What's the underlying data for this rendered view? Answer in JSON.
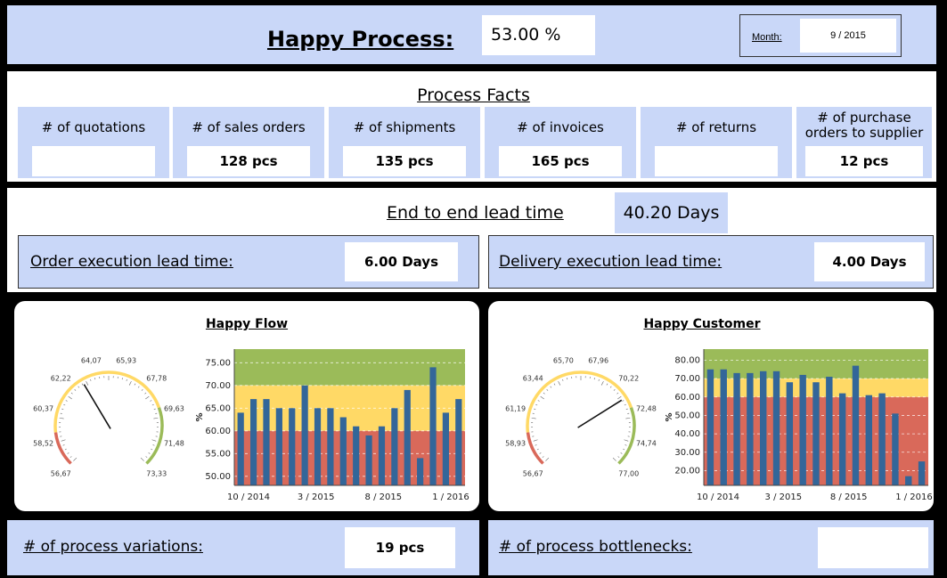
{
  "header": {
    "title": "Happy Process:",
    "happy_process_value": "53.00 %",
    "month_label": "Month:",
    "month_value": "9 / 2015"
  },
  "process_facts": {
    "title": "Process Facts",
    "items": [
      {
        "label": "# of quotations",
        "value": ""
      },
      {
        "label": "# of sales orders",
        "value": "128 pcs"
      },
      {
        "label": "# of shipments",
        "value": "135 pcs"
      },
      {
        "label": "# of invoices",
        "value": "165 pcs"
      },
      {
        "label": "# of returns",
        "value": ""
      },
      {
        "label": "# of purchase orders to supplier",
        "value": "12 pcs"
      }
    ]
  },
  "lead_time": {
    "end_to_end_label": "End to end lead time",
    "end_to_end_value": "40.20 Days",
    "order_label": "Order execution lead time:",
    "order_value": "6.00 Days",
    "delivery_label": "Delivery execution lead time:",
    "delivery_value": "4.00 Days"
  },
  "bottom": {
    "variations_label": "# of process variations:",
    "variations_value": "19 pcs",
    "bottlenecks_label": "# of process bottlenecks:",
    "bottlenecks_value": ""
  },
  "colors": {
    "panel_blue": "#c9d7f8",
    "band_green": "#9bbb59",
    "band_yellow": "#ffd966",
    "band_red": "#d9695a",
    "bar_blue": "#336699"
  },
  "chart_data": [
    {
      "title": "Happy Flow",
      "type": "gauge",
      "tick_labels": [
        "56,67",
        "58,52",
        "60,37",
        "62,22",
        "64,07",
        "65,93",
        "67,78",
        "69,63",
        "71,48",
        "73,33"
      ],
      "min": 56.67,
      "max": 73.33,
      "value": 63.1
    },
    {
      "title": "Happy Flow",
      "type": "bar",
      "ylabel": "%",
      "ylim": [
        48,
        78
      ],
      "yticks": [
        "75.00",
        "70.00",
        "65.00",
        "60.00",
        "55.00",
        "50.00"
      ],
      "xticks": [
        "10 / 2014",
        "3 / 2015",
        "8 / 2015",
        "1 / 2016"
      ],
      "bands": {
        "red": [
          48,
          60
        ],
        "yellow": [
          60,
          70
        ],
        "green": [
          70,
          78
        ]
      },
      "series": [
        {
          "values": [
            64,
            67,
            67,
            65,
            65,
            70,
            65,
            65,
            63,
            61,
            59,
            61,
            65,
            69,
            54,
            74,
            64,
            67
          ]
        }
      ]
    },
    {
      "title": "Happy Customer",
      "type": "gauge",
      "tick_labels": [
        "56,67",
        "58,93",
        "61,19",
        "63,44",
        "65,70",
        "67,96",
        "70,22",
        "72,48",
        "74,74",
        "77,00"
      ],
      "min": 56.67,
      "max": 77.0,
      "value": 71.2
    },
    {
      "title": "Happy Customer",
      "type": "bar",
      "ylabel": "%",
      "ylim": [
        12,
        86
      ],
      "yticks": [
        "80.00",
        "70.00",
        "60.00",
        "50.00",
        "40.00",
        "30.00",
        "20.00"
      ],
      "xticks": [
        "10 / 2014",
        "3 / 2015",
        "8 / 2015",
        "1 / 2016"
      ],
      "bands": {
        "red": [
          12,
          60
        ],
        "yellow": [
          60,
          70
        ],
        "green": [
          70,
          86
        ]
      },
      "series": [
        {
          "values": [
            75,
            75,
            73,
            73,
            74,
            74,
            68,
            72,
            68,
            71,
            62,
            77,
            61,
            62,
            51,
            17,
            25
          ]
        }
      ]
    }
  ]
}
